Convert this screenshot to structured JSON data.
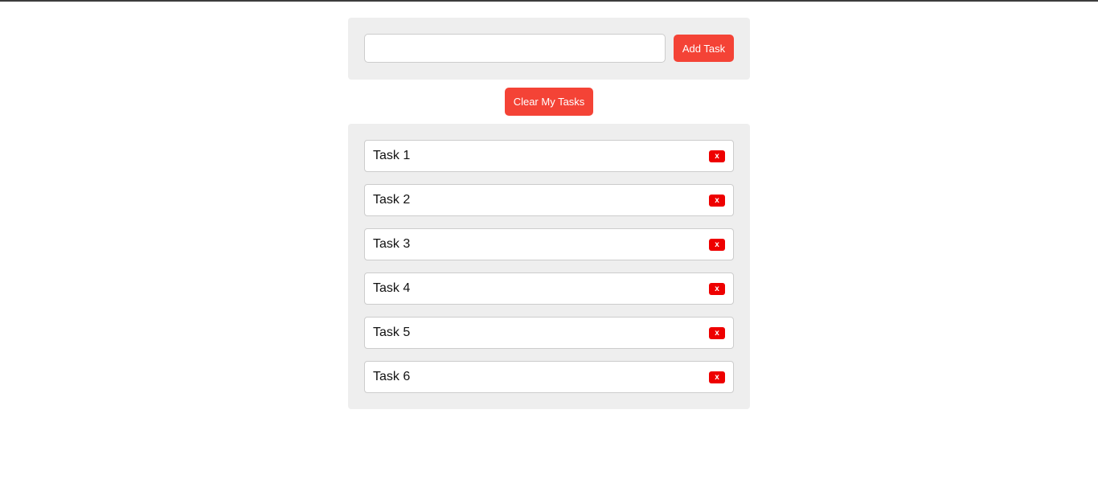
{
  "colors": {
    "accent": "#f44336",
    "danger": "#ee0000",
    "panel_background": "#eeeeee"
  },
  "input": {
    "value": "",
    "placeholder": ""
  },
  "add_button_label": "Add Task",
  "clear_button_label": "Clear My Tasks",
  "tasks": [
    {
      "label": "Task 1",
      "delete_label": "x"
    },
    {
      "label": "Task 2",
      "delete_label": "x"
    },
    {
      "label": "Task 3",
      "delete_label": "x"
    },
    {
      "label": "Task 4",
      "delete_label": "x"
    },
    {
      "label": "Task 5",
      "delete_label": "x"
    },
    {
      "label": "Task 6",
      "delete_label": "x"
    }
  ]
}
